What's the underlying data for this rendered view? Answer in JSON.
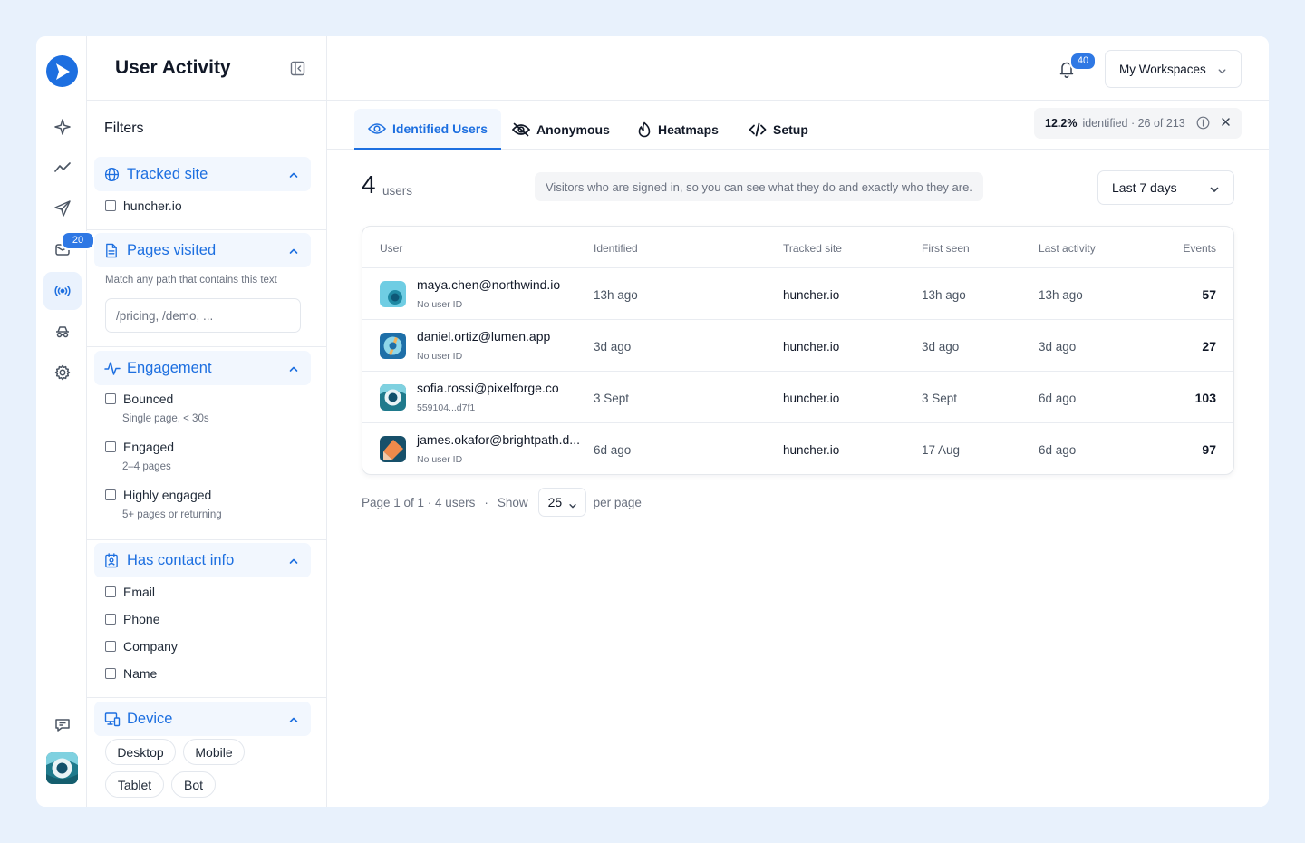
{
  "sidebar": {
    "badge": "20",
    "icons": [
      "logo-icon",
      "sparkle-icon",
      "trend-icon",
      "send-icon",
      "inbox-icon",
      "live-signal-icon",
      "incognito-icon",
      "gear-icon",
      "feedback-icon",
      "avatar"
    ]
  },
  "filters": {
    "page_title": "User Activity",
    "heading": "Filters",
    "tracked_site": {
      "title": "Tracked site",
      "options": [
        "huncher.io"
      ]
    },
    "pages_visited": {
      "title": "Pages visited",
      "hint": "Match any path that contains this text",
      "placeholder": "/pricing, /demo, ..."
    },
    "engagement": {
      "title": "Engagement",
      "options": [
        {
          "label": "Bounced",
          "sub": "Single page, < 30s"
        },
        {
          "label": "Engaged",
          "sub": "2–4 pages"
        },
        {
          "label": "Highly engaged",
          "sub": "5+ pages or returning"
        }
      ]
    },
    "contact": {
      "title": "Has contact info",
      "options": [
        "Email",
        "Phone",
        "Company",
        "Name"
      ]
    },
    "device": {
      "title": "Device",
      "options": [
        "Desktop",
        "Mobile",
        "Tablet",
        "Bot"
      ]
    }
  },
  "header": {
    "notifications": "40",
    "workspace": "My Workspaces"
  },
  "tabs": [
    {
      "label": "Identified Users",
      "icon": "eye-icon",
      "active": true
    },
    {
      "label": "Anonymous",
      "icon": "eye-off-icon",
      "active": false
    },
    {
      "label": "Heatmaps",
      "icon": "flame-icon",
      "active": false
    },
    {
      "label": "Setup",
      "icon": "code-icon",
      "active": false
    }
  ],
  "identified": {
    "pct": "12.2%",
    "text": "identified · 26 of 213"
  },
  "summary": {
    "count": "4",
    "unit": "users",
    "description": "Visitors who are signed in, so you can see what they do and exactly who they are.",
    "range": "Last 7 days"
  },
  "table": {
    "columns": [
      "User",
      "Identified",
      "Tracked site",
      "First seen",
      "Last activity",
      "Events"
    ],
    "rows": [
      {
        "email": "maya.chen@northwind.io",
        "uid": "No user ID",
        "identified": "13h ago",
        "site": "huncher.io",
        "first_seen": "13h ago",
        "last_activity": "13h ago",
        "events": "57"
      },
      {
        "email": "daniel.ortiz@lumen.app",
        "uid": "No user ID",
        "identified": "3d ago",
        "site": "huncher.io",
        "first_seen": "3d ago",
        "last_activity": "3d ago",
        "events": "27"
      },
      {
        "email": "sofia.rossi@pixelforge.co",
        "uid": "559104...d7f1",
        "identified": "3 Sept",
        "site": "huncher.io",
        "first_seen": "3 Sept",
        "last_activity": "6d ago",
        "events": "103"
      },
      {
        "email": "james.okafor@brightpath.d...",
        "uid": "No user ID",
        "identified": "6d ago",
        "site": "huncher.io",
        "first_seen": "17 Aug",
        "last_activity": "6d ago",
        "events": "97"
      }
    ]
  },
  "pagination": {
    "page": "Page 1 of 1 · 4 users",
    "sep": "·",
    "show": "Show",
    "per_page": "25",
    "per_page_label": "per page"
  },
  "colors": {
    "accent": "#1d6fe0",
    "accent_bg": "#f2f7fe",
    "badge": "#2f78e4",
    "page_bg": "#e8f1fc"
  }
}
